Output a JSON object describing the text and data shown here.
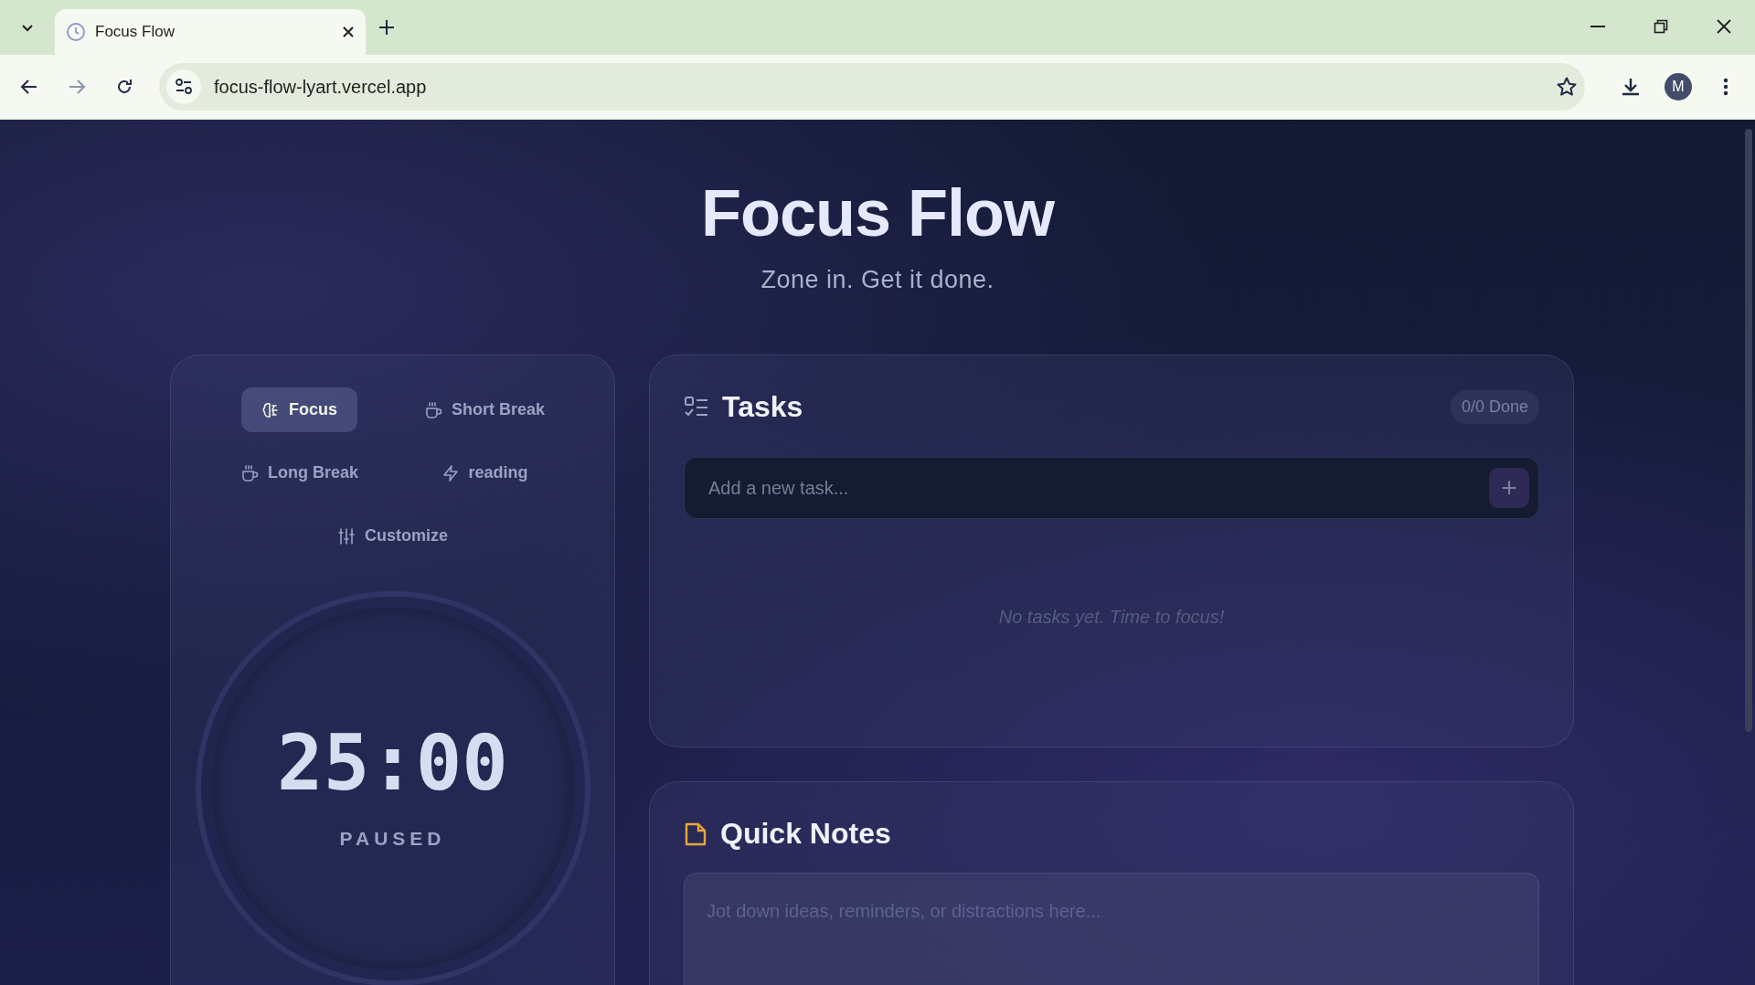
{
  "browser": {
    "tab": {
      "title": "Focus Flow"
    },
    "url": "focus-flow-lyart.vercel.app",
    "profile_initial": "M"
  },
  "header": {
    "title": "Focus Flow",
    "subtitle": "Zone in. Get it done."
  },
  "timer": {
    "modes": [
      {
        "label": "Focus",
        "kind": "focus",
        "selected": true
      },
      {
        "label": "Short Break",
        "kind": "break",
        "selected": false
      },
      {
        "label": "Long Break",
        "kind": "break",
        "selected": false
      },
      {
        "label": "reading",
        "kind": "custom",
        "selected": false
      }
    ],
    "customize": "Customize",
    "time": "25:00",
    "status": "PAUSED"
  },
  "tasks": {
    "title": "Tasks",
    "count": "0/0 Done",
    "input": {
      "placeholder": "Add a new task..."
    },
    "add_button": "+",
    "empty": "No tasks yet. Time to focus!"
  },
  "notes": {
    "title": "Quick Notes",
    "placeholder": "Jot down ideas, reminders, or distractions here..."
  }
}
